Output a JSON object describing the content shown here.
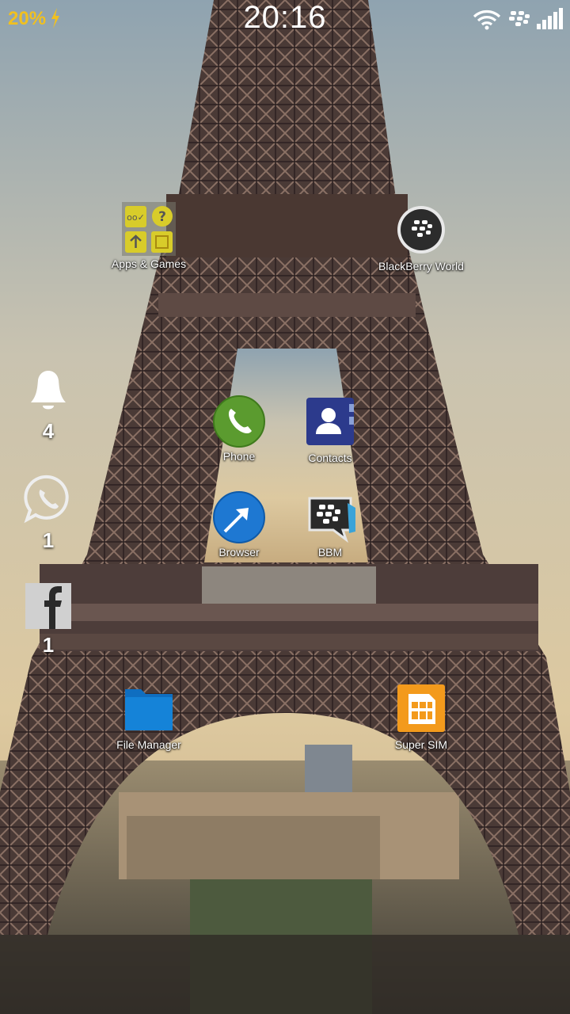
{
  "status_bar": {
    "battery": "20%",
    "time": "20:16",
    "icons": [
      "lightning-icon",
      "wifi-icon",
      "blackberry-icon",
      "signal-icon"
    ]
  },
  "apps": {
    "apps_games": "Apps & Games",
    "blackberry_world": "BlackBerry World",
    "phone": "Phone",
    "contacts": "Contacts",
    "browser": "Browser",
    "bbm": "BBM",
    "file_manager": "File Manager",
    "super_sim": "Super SIM"
  },
  "notifications": {
    "bell_count": "4",
    "whatsapp_count": "1",
    "facebook_count": "1"
  },
  "colors": {
    "battery": "#f0c020",
    "phone": "#5b9b2f",
    "contacts": "#2c3a8c",
    "browser": "#1e78d2",
    "file_manager": "#1583d8",
    "super_sim": "#f39a1c"
  }
}
